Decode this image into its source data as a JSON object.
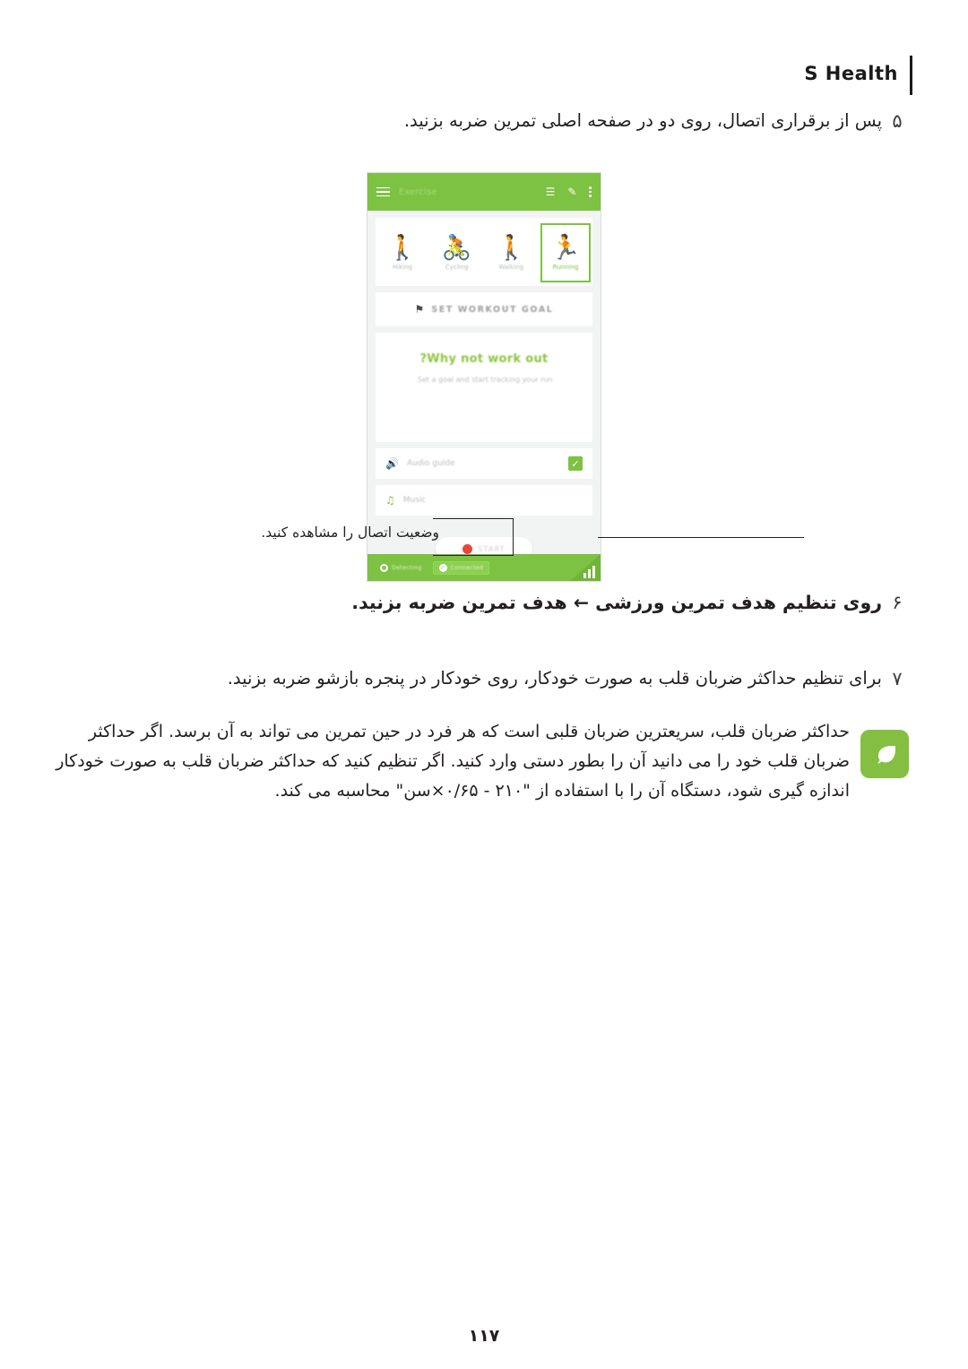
{
  "header": {
    "title": "S Health"
  },
  "steps": [
    {
      "number": "۵",
      "text": "پس از برقراری اتصال، روی دو در صفحه اصلی تمرین ضربه بزنید."
    },
    {
      "number": "۶",
      "text": "روی تنظیم هدف تمرین ورزشی ← هدف تمرین ضربه بزنید."
    },
    {
      "number": "۷",
      "text": "برای تنظیم حداکثر ضربان قلب به صورت خودکار، روی خودکار در پنجره بازشو ضربه بزنید."
    }
  ],
  "note": {
    "icon": "leaf-icon",
    "text": "حداکثر ضربان قلب، سریعترین ضربان قلبی است که هر فرد در حین تمرین می تواند به آن برسد. اگر حداکثر ضربان قلب خود را می دانید آن را بطور دستی وارد کنید. اگر تنظیم کنید که حداکثر ضربان قلب به صورت خودکار اندازه گیری شود، دستگاه آن را با استفاده از \"۲۱۰ - ۰/۶۵×سن\" محاسبه می کند."
  },
  "callout": {
    "text": "وضعیت اتصال را مشاهده کنید."
  },
  "phone": {
    "topbar": {
      "menu_icon": "hamburger-menu-icon",
      "title": "Exercise",
      "list_icon": "list-icon",
      "edit_icon": "pencil-edit-icon",
      "more_icon": "more-options-icon"
    },
    "activities": [
      {
        "icon": "running-icon",
        "label": "Running",
        "selected": true
      },
      {
        "icon": "walking-icon",
        "label": "Walking",
        "selected": false
      },
      {
        "icon": "cycling-icon",
        "label": "Cycling",
        "selected": false
      },
      {
        "icon": "hiking-icon",
        "label": "Hiking",
        "selected": false
      }
    ],
    "goal_button": {
      "icon": "flag-icon",
      "label": "SET WORKOUT GOAL"
    },
    "promo": {
      "title": "Why not work out?",
      "subtitle": "Set a goal and start tracking your run."
    },
    "options": [
      {
        "icon": "audio-guide-icon",
        "label": "Audio guide",
        "checked": true
      },
      {
        "icon": "music-note-icon",
        "label": "Music",
        "checked": false
      }
    ],
    "start_button": {
      "icon": "record-dot-icon",
      "label": "START"
    },
    "footer": {
      "chips": [
        {
          "icon": "location-pin-icon",
          "label": "Detecting",
          "highlighted": false
        },
        {
          "icon": "check-circle-icon",
          "label": "Connected",
          "highlighted": true
        }
      ],
      "signal_icon": "signal-bars-icon"
    }
  },
  "footer": {
    "page_number": "۱۱۷"
  },
  "colors": {
    "accent_green": "#7dc242",
    "record_red": "#e8453c",
    "text": "#231f20"
  }
}
